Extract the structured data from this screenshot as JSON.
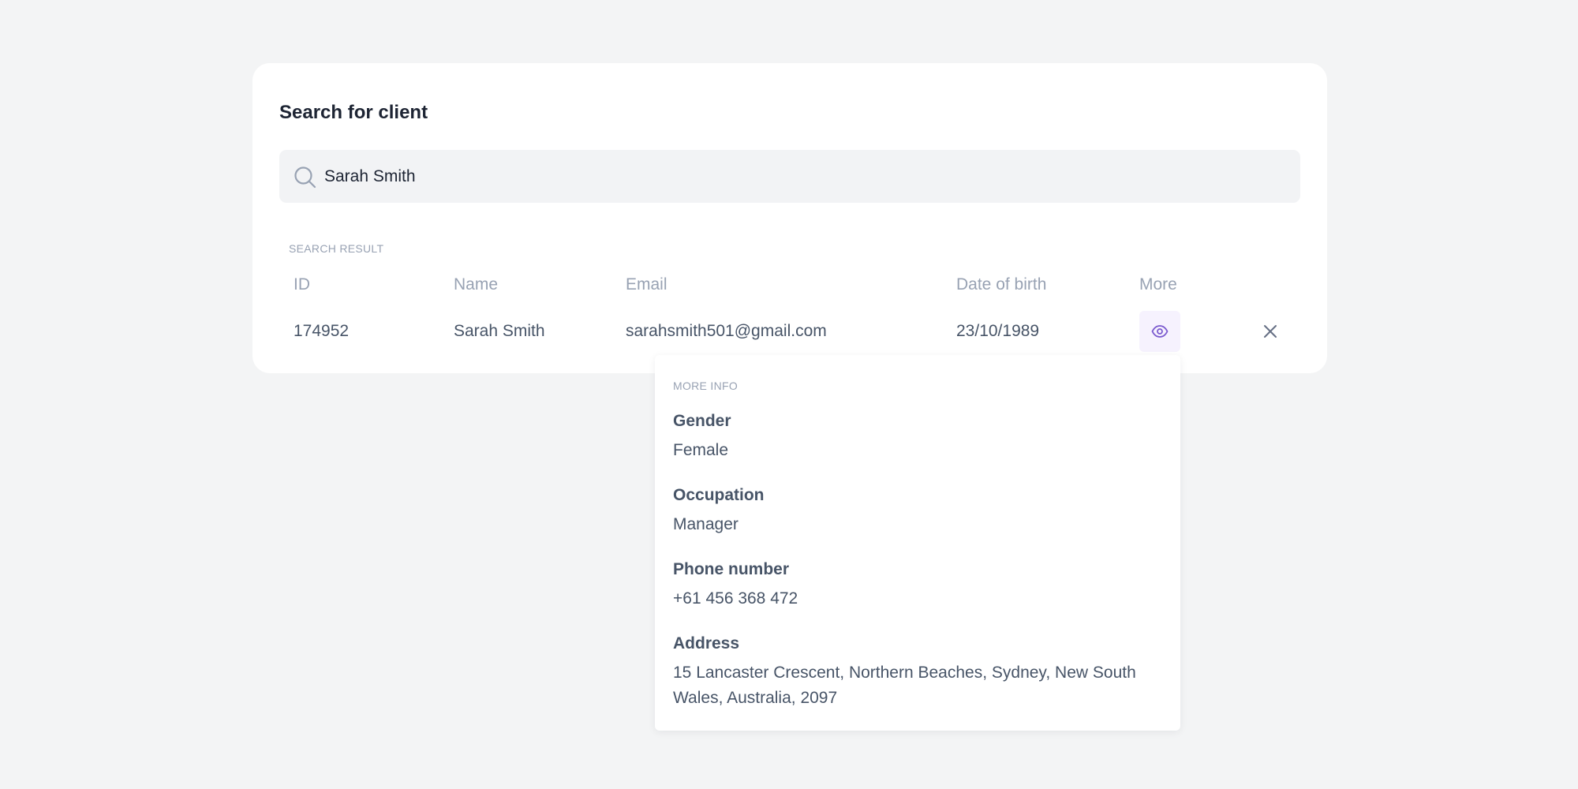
{
  "card": {
    "title": "Search for client"
  },
  "search": {
    "value": "Sarah Smith",
    "icon": "search-icon"
  },
  "results": {
    "section_label": "SEARCH RESULT",
    "columns": {
      "id": "ID",
      "name": "Name",
      "email": "Email",
      "dob": "Date of birth",
      "more": "More"
    },
    "row": {
      "id": "174952",
      "name": "Sarah Smith",
      "email": "sarahsmith501@gmail.com",
      "dob": "23/10/1989"
    },
    "actions": {
      "view_icon": "eye-icon",
      "close_icon": "close-icon"
    }
  },
  "more_info": {
    "section_label": "MORE INFO",
    "fields": [
      {
        "label": "Gender",
        "value": "Female"
      },
      {
        "label": "Occupation",
        "value": "Manager"
      },
      {
        "label": "Phone number",
        "value": "+61 456 368 472"
      },
      {
        "label": "Address",
        "value": "15 Lancaster Crescent, Northern Beaches, Sydney, New South Wales, Australia, 2097"
      }
    ]
  },
  "colors": {
    "background": "#f3f4f5",
    "card": "#ffffff",
    "title_text": "#1d2433",
    "body_text": "#475467",
    "muted_text": "#98a2b3",
    "accent": "#7c5ccf",
    "accent_bg": "#f6f2fe"
  }
}
